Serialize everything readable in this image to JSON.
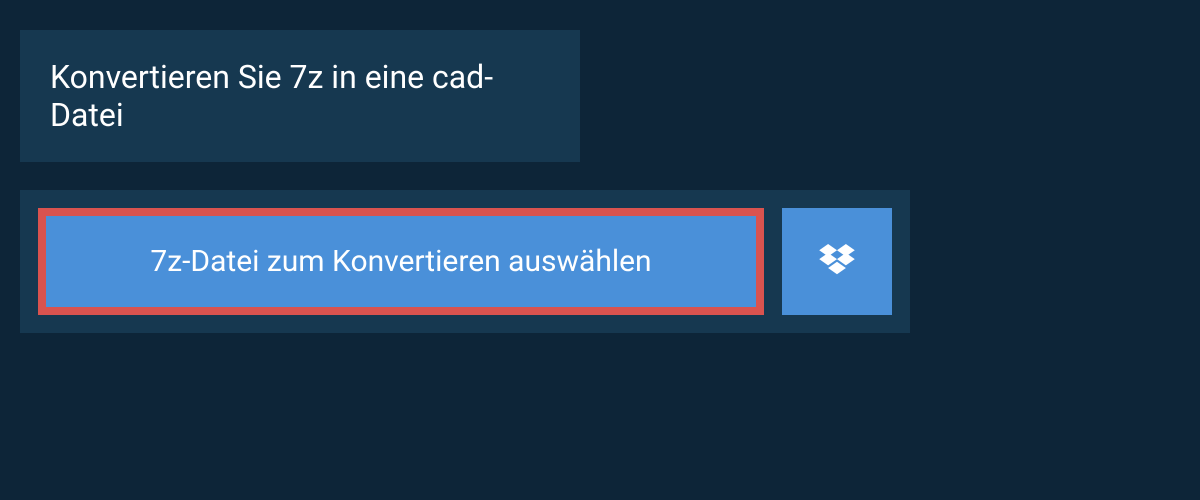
{
  "header": {
    "title": "Konvertieren Sie 7z in eine cad-Datei"
  },
  "actions": {
    "select_file_label": "7z-Datei zum Konvertieren auswählen",
    "dropbox_icon_name": "dropbox-icon"
  },
  "colors": {
    "background": "#0d2538",
    "panel": "#163850",
    "button_primary": "#4a90d9",
    "highlight_border": "#d9534f",
    "text": "#ffffff"
  }
}
